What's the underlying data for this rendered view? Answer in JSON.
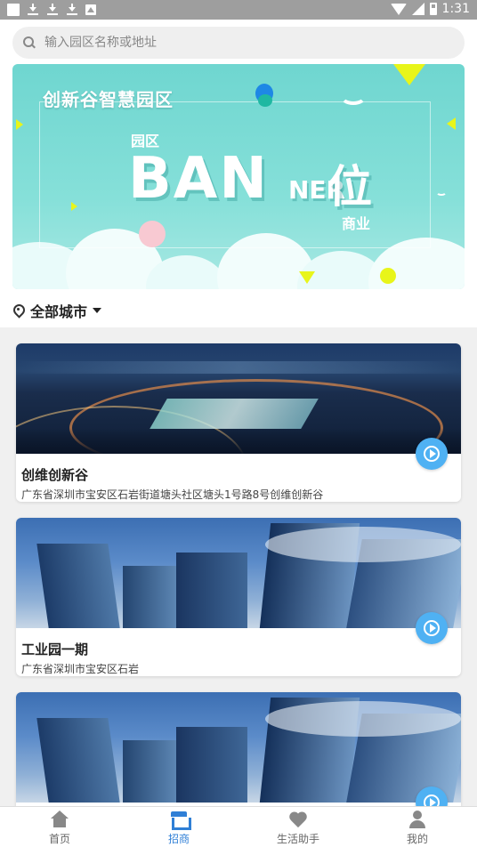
{
  "status_bar": {
    "time": "1:31"
  },
  "search": {
    "placeholder": "输入园区名称或地址"
  },
  "banner": {
    "title": "创新谷智慧园区",
    "park": "园区",
    "big_text_1": "BAN",
    "big_text_2": "NER",
    "big_text_3": "位",
    "biz": "商业"
  },
  "city_filter": {
    "label": "全部城市"
  },
  "parks": [
    {
      "name": "创维创新谷",
      "address": "广东省深圳市宝安区石岩街道塘头社区塘头1号路8号创维创新谷"
    },
    {
      "name": "工业园一期",
      "address": "广东省深圳市宝安区石岩"
    },
    {
      "name": "",
      "address": ""
    }
  ],
  "bottom_nav": [
    {
      "label": "首页",
      "icon": "home-icon",
      "active": false
    },
    {
      "label": "招商",
      "icon": "shop-icon",
      "active": true
    },
    {
      "label": "生活助手",
      "icon": "heart-icon",
      "active": false
    },
    {
      "label": "我的",
      "icon": "user-icon",
      "active": false
    }
  ],
  "colors": {
    "accent": "#2f7fd6",
    "play_button": "#4fb1f3",
    "banner_bg": "#7ddbd4"
  }
}
